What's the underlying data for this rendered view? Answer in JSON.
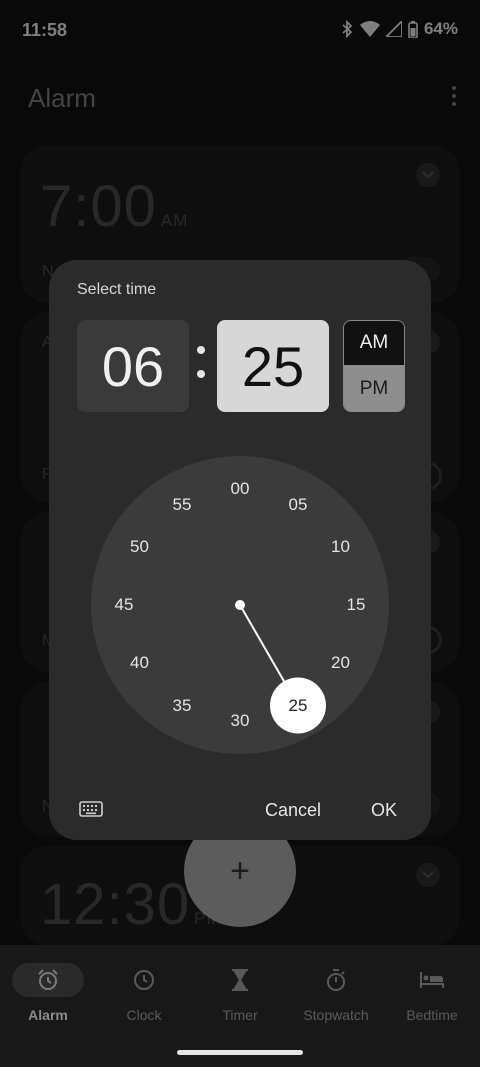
{
  "status_bar": {
    "time": "11:58",
    "battery": "64%"
  },
  "app": {
    "title": "Alarm"
  },
  "alarms": [
    {
      "time": "7:00",
      "ampm": "AM",
      "detail_initial": "N"
    },
    {
      "detail_initial": "A",
      "repeat_initial": "F"
    },
    {
      "repeat_initial": "M"
    },
    {
      "repeat_initial": "N"
    },
    {
      "time": "12:30",
      "ampm": "PM"
    }
  ],
  "fab": {
    "label": "+"
  },
  "dialog": {
    "title": "Select time",
    "hour": "06",
    "minute": "25",
    "separator": ":",
    "am_label": "AM",
    "pm_label": "PM",
    "selected_period": "PM",
    "dial_numbers": [
      "00",
      "05",
      "10",
      "15",
      "20",
      "25",
      "30",
      "35",
      "40",
      "45",
      "50",
      "55"
    ],
    "selected_minute": 25,
    "cancel_label": "Cancel",
    "ok_label": "OK"
  },
  "nav": {
    "items": [
      {
        "label": "Alarm",
        "icon": "alarm-clock-icon",
        "active": true
      },
      {
        "label": "Clock",
        "icon": "clock-icon",
        "active": false
      },
      {
        "label": "Timer",
        "icon": "hourglass-icon",
        "active": false
      },
      {
        "label": "Stopwatch",
        "icon": "stopwatch-icon",
        "active": false
      },
      {
        "label": "Bedtime",
        "icon": "bed-icon",
        "active": false
      }
    ]
  },
  "colors": {
    "background": "#121212",
    "dialog": "#2b2b2b",
    "dial": "#3b3b3b",
    "selected_minute_box": "#d7d7d7",
    "pm_selected": "#8e8e8e"
  }
}
